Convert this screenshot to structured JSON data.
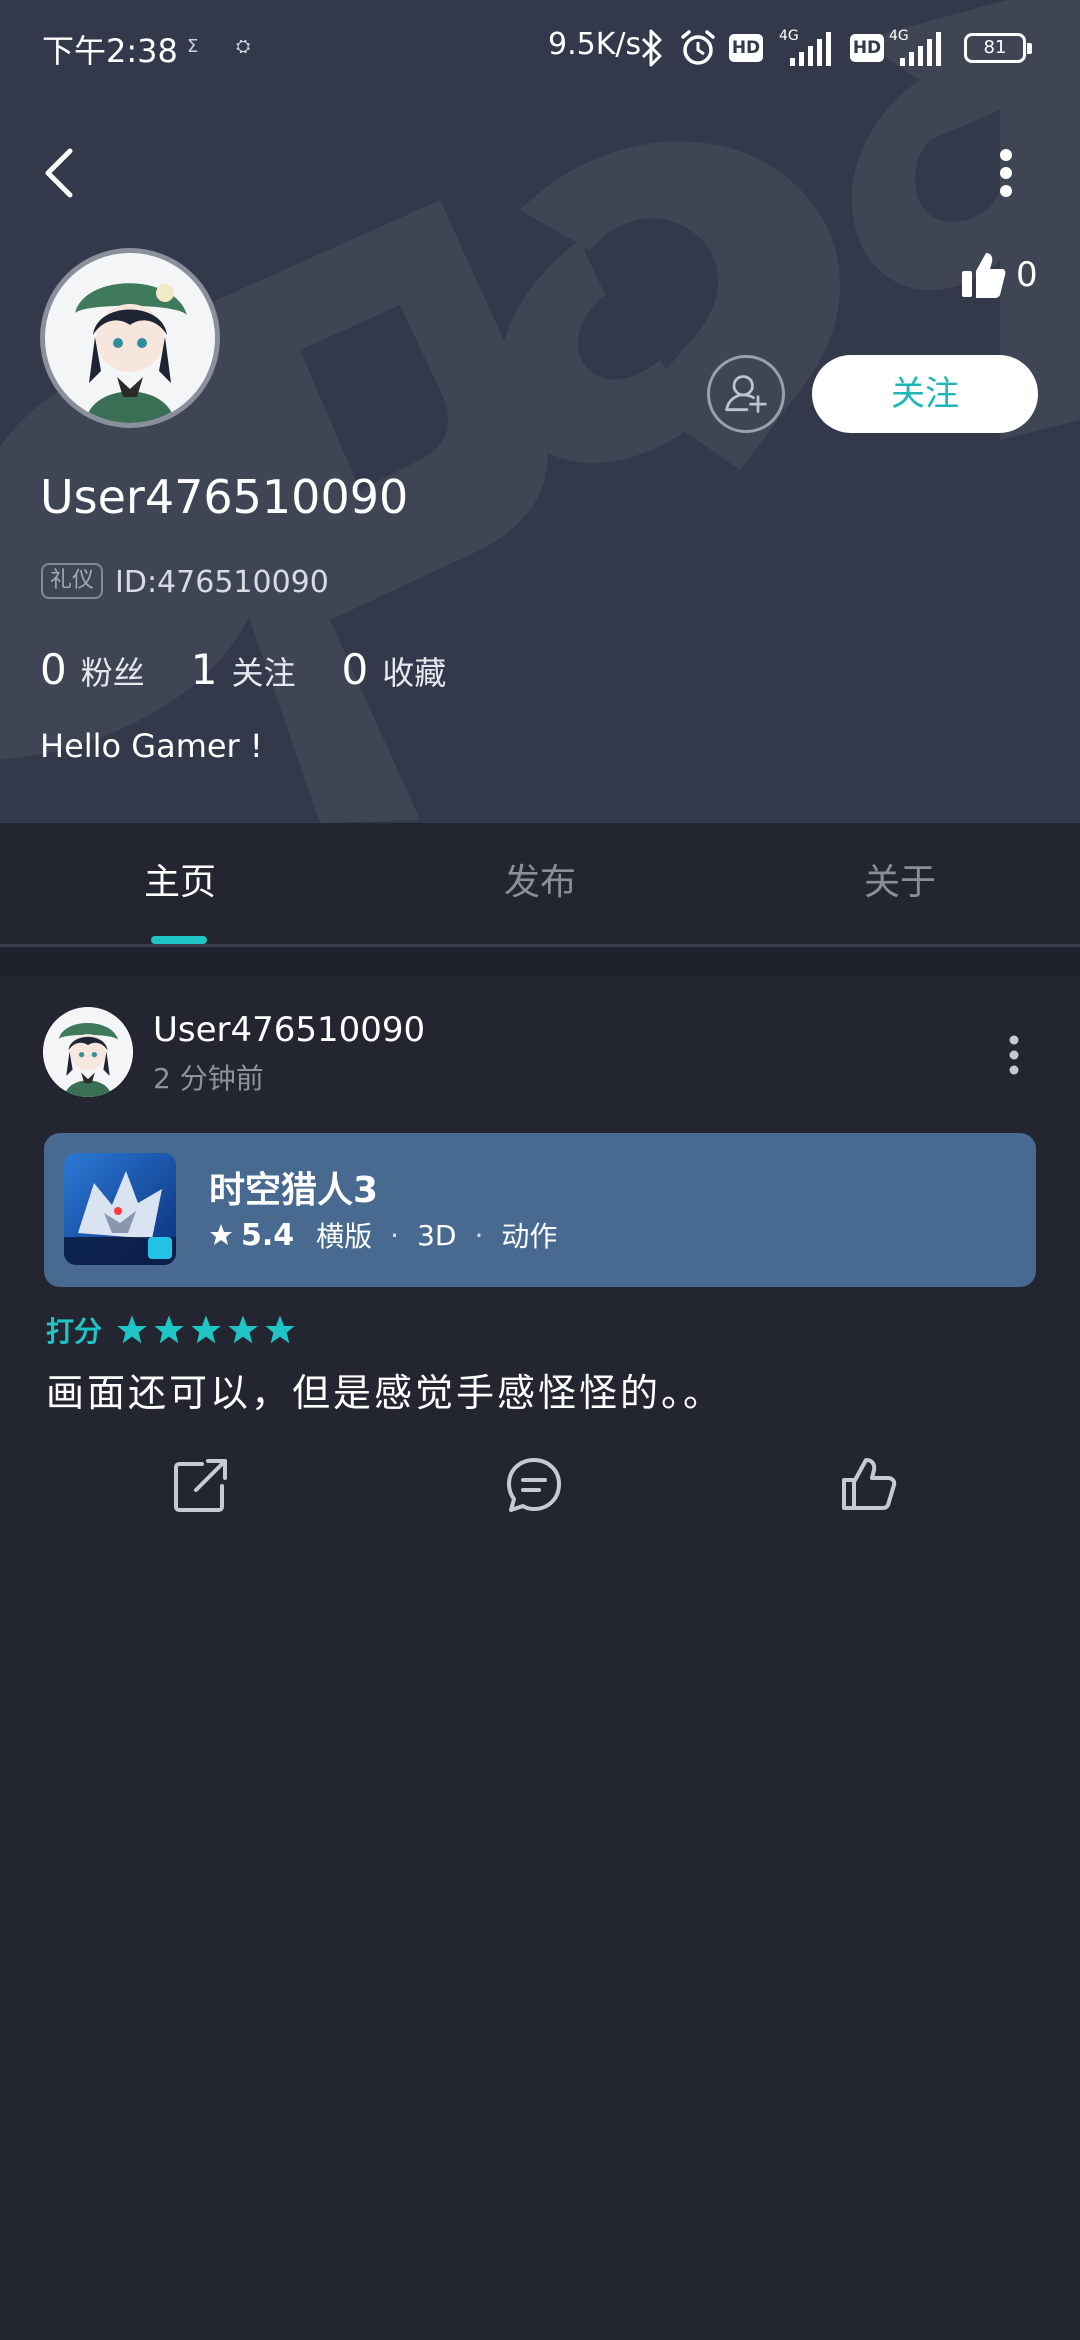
{
  "status_bar": {
    "time": "下午2:38",
    "mini_icons": [
      "Σ",
      "⛭"
    ],
    "network_speed": "9.5K/s",
    "hd_label": "HD",
    "net_label": "4G",
    "battery": "81"
  },
  "header": {
    "likes": "0",
    "follow_label": "关注",
    "username": "User476510090",
    "role_badge": "礼仪",
    "user_id": "ID:476510090",
    "stats": [
      {
        "num": "0",
        "label": "粉丝"
      },
      {
        "num": "1",
        "label": "关注"
      },
      {
        "num": "0",
        "label": "收藏"
      }
    ],
    "bio": "Hello Gamer !",
    "watermark_text": "tapTap"
  },
  "tabs": [
    {
      "label": "主页",
      "active": true
    },
    {
      "label": "发布",
      "active": false
    },
    {
      "label": "关于",
      "active": false
    }
  ],
  "post": {
    "author": "User476510090",
    "time": "2 分钟前",
    "game": {
      "name": "时空猎人3",
      "score": "5.4",
      "tags": [
        "横版",
        "3D",
        "动作"
      ],
      "icon_text": "时空猎人3"
    },
    "rating_label": "打分",
    "stars": 5,
    "comment": "画面还可以，但是感觉手感怪怪的。。"
  },
  "colors": {
    "header_bg": "#33394a",
    "page_bg": "#232631",
    "accent": "#1fc4c4",
    "game_card_bg": "#486a91"
  },
  "icons": [
    "back-arrow-icon",
    "more-vertical-icon",
    "thumbs-up-icon",
    "add-friend-icon",
    "share-icon",
    "comment-icon",
    "star-icon",
    "bluetooth-icon",
    "alarm-icon",
    "signal-icon",
    "battery-icon"
  ]
}
